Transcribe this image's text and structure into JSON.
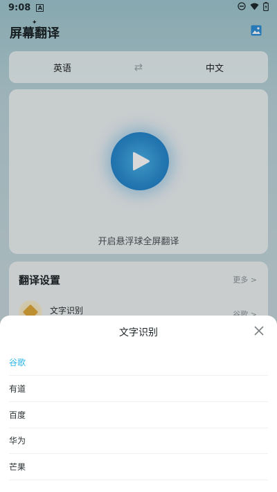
{
  "status_bar": {
    "time": "9:08",
    "notification_badge": "A"
  },
  "app": {
    "title": "屏幕翻译"
  },
  "language_bar": {
    "source": "英语",
    "target": "中文",
    "swap_icon": "swap-arrows-icon"
  },
  "main_card": {
    "caption": "开启悬浮球全屏翻译",
    "accent_color": "#2b8ed0"
  },
  "settings": {
    "title": "翻译设置",
    "more": "更多 >",
    "item_label": "文字识别",
    "item_value": "谷歌 >"
  },
  "sheet": {
    "title": "文字识别",
    "options": [
      {
        "label": "谷歌",
        "selected": true
      },
      {
        "label": "有道",
        "selected": false
      },
      {
        "label": "百度",
        "selected": false
      },
      {
        "label": "华为",
        "selected": false
      },
      {
        "label": "芒果",
        "selected": false
      }
    ],
    "selected_color": "#2bb4e6"
  }
}
